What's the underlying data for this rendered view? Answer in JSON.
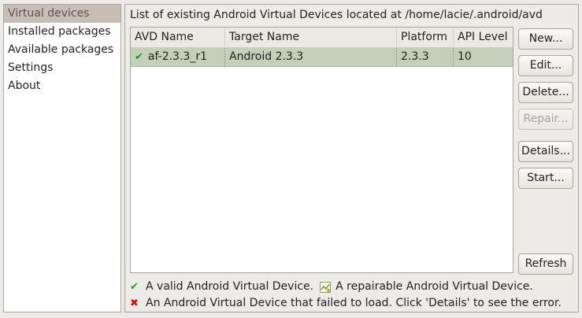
{
  "nav": {
    "items": [
      {
        "label": "Virtual devices",
        "selected": true
      },
      {
        "label": "Installed packages",
        "selected": false
      },
      {
        "label": "Available packages",
        "selected": false
      },
      {
        "label": "Settings",
        "selected": false
      },
      {
        "label": "About",
        "selected": false
      }
    ]
  },
  "panel": {
    "title": "List of existing Android Virtual Devices located at /home/lacie/.android/avd"
  },
  "table": {
    "columns": [
      "AVD Name",
      "Target Name",
      "Platform",
      "API Level"
    ],
    "rows": [
      {
        "status_icon": "check-icon",
        "avd_name": "af-2.3.3_r1",
        "target_name": "Android 2.3.3",
        "platform": "2.3.3",
        "api_level": "10"
      }
    ]
  },
  "buttons": {
    "new": "New...",
    "edit": "Edit...",
    "delete": "Delete...",
    "repair": "Repair...",
    "details": "Details...",
    "start": "Start...",
    "refresh": "Refresh"
  },
  "legend": {
    "valid": "A valid Android Virtual Device.",
    "repairable": "A repairable Android Virtual Device.",
    "failed": "An Android Virtual Device that failed to load. Click 'Details' to see the error."
  },
  "colors": {
    "selected_row": "#c3cfb9",
    "valid_green": "#1d9e1d",
    "error_red": "#cc1111"
  }
}
